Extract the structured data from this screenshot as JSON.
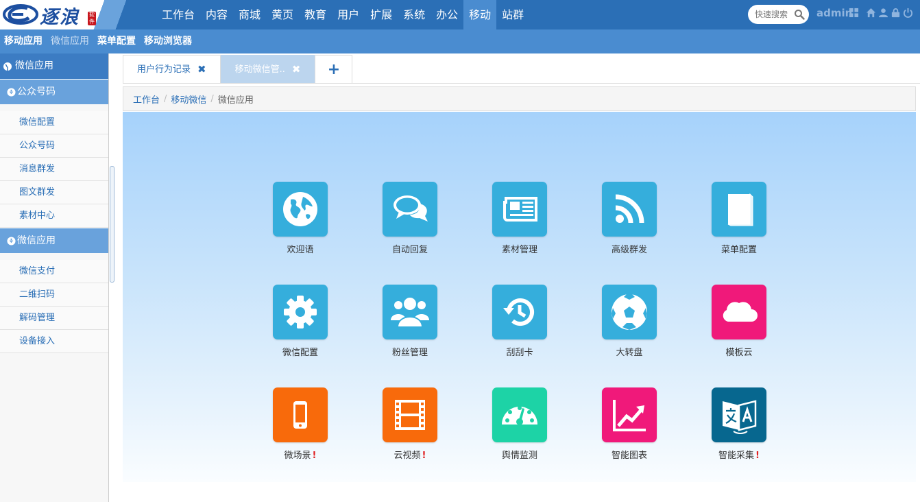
{
  "brand": {
    "logo_text": "逐浪",
    "seal_text": "软件"
  },
  "nav": {
    "items": [
      "工作台",
      "内容",
      "商城",
      "黄页",
      "教育",
      "用户",
      "扩展",
      "系统",
      "办公",
      "移动",
      "站群"
    ],
    "active_index": 9
  },
  "search": {
    "placeholder": "快速搜索"
  },
  "user": {
    "name": "admin"
  },
  "subnav": {
    "items": [
      "移动应用",
      "微信应用",
      "菜单配置",
      "移动浏览器"
    ]
  },
  "sidebar": {
    "title": "微信应用",
    "groups": [
      {
        "label": "公众号码",
        "items": [
          "微信配置",
          "公众号码",
          "消息群发",
          "图文群发",
          "素材中心"
        ]
      },
      {
        "label": "微信应用",
        "items": [
          "微信支付",
          "二维扫码",
          "解码管理",
          "设备接入"
        ]
      }
    ]
  },
  "tabs": {
    "items": [
      "用户行为记录",
      "移动微信管.."
    ],
    "close_glyph": "✖",
    "add_glyph": "+"
  },
  "breadcrumb": {
    "items": [
      "工作台",
      "移动微信",
      "微信应用"
    ],
    "separator": "/"
  },
  "apps": [
    {
      "label": "欢迎语",
      "icon": "globe-icon",
      "color": "#35aedc"
    },
    {
      "label": "自动回复",
      "icon": "chat-bubbles-icon",
      "color": "#35aedc"
    },
    {
      "label": "素材管理",
      "icon": "newspaper-icon",
      "color": "#35aedc"
    },
    {
      "label": "高级群发",
      "icon": "rss-icon",
      "color": "#35aedc"
    },
    {
      "label": "菜单配置",
      "icon": "book-icon",
      "color": "#35aedc"
    },
    {
      "label": "微信配置",
      "icon": "gear-icon",
      "color": "#35aedc"
    },
    {
      "label": "粉丝管理",
      "icon": "users-icon",
      "color": "#35aedc"
    },
    {
      "label": "刮刮卡",
      "icon": "history-icon",
      "color": "#35aedc"
    },
    {
      "label": "大转盘",
      "icon": "soccer-ball-icon",
      "color": "#35aedc"
    },
    {
      "label": "模板云",
      "icon": "cloud-icon",
      "color": "#f0197a"
    },
    {
      "label": "微场景",
      "icon": "mobile-icon",
      "color": "#f86a0b",
      "alert": "!"
    },
    {
      "label": "云视频",
      "icon": "film-icon",
      "color": "#f86a0b",
      "alert": "!"
    },
    {
      "label": "舆情监测",
      "icon": "dashboard-icon",
      "color": "#1dd3a6"
    },
    {
      "label": "智能图表",
      "icon": "area-chart-icon",
      "color": "#f0197a"
    },
    {
      "label": "智能采集",
      "icon": "translate-icon",
      "color": "#07678f",
      "alert": "!"
    }
  ]
}
